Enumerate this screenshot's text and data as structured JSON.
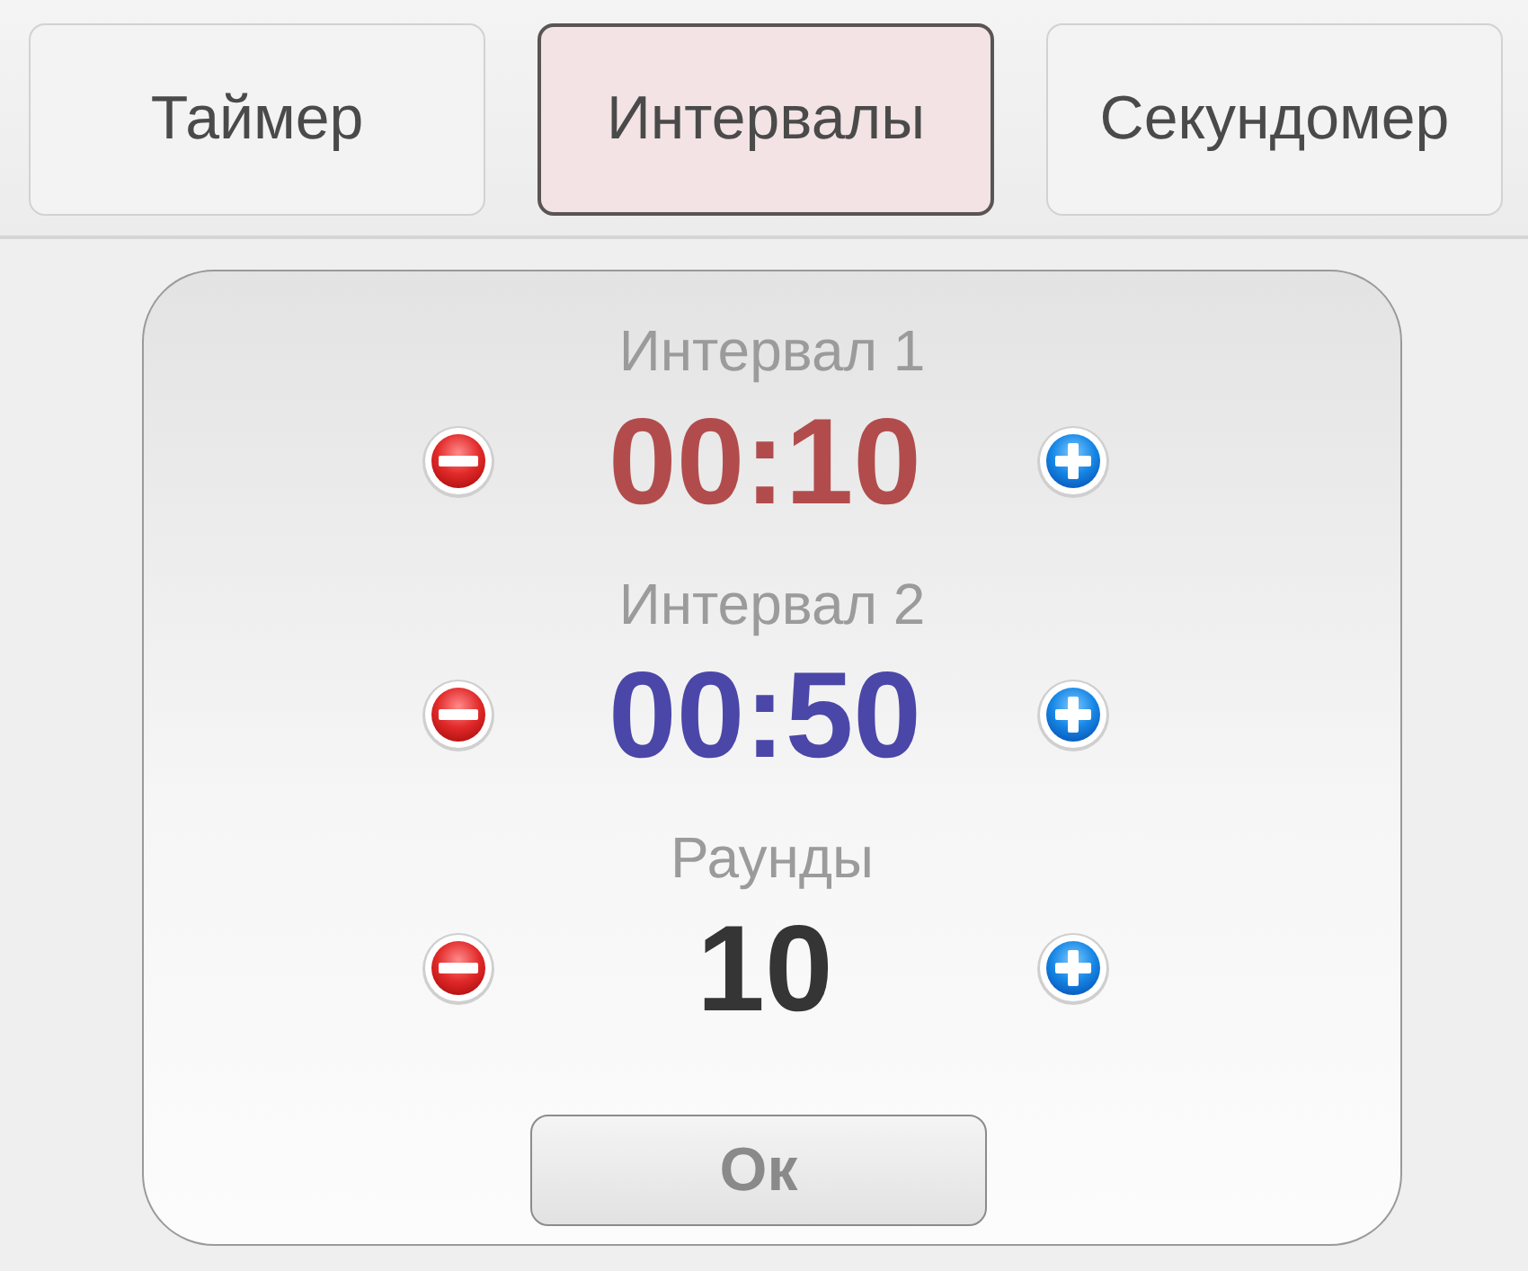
{
  "tabs": [
    {
      "label": "Таймер",
      "selected": false
    },
    {
      "label": "Интервалы",
      "selected": true
    },
    {
      "label": "Секундомер",
      "selected": false
    }
  ],
  "settings": [
    {
      "label": "Интервал 1",
      "value": "00:10",
      "color": "#b24c4c"
    },
    {
      "label": "Интервал 2",
      "value": "00:50",
      "color": "#4b47a8"
    },
    {
      "label": "Раунды",
      "value": "10",
      "color": "#353535"
    }
  ],
  "ok_button": "Ок"
}
